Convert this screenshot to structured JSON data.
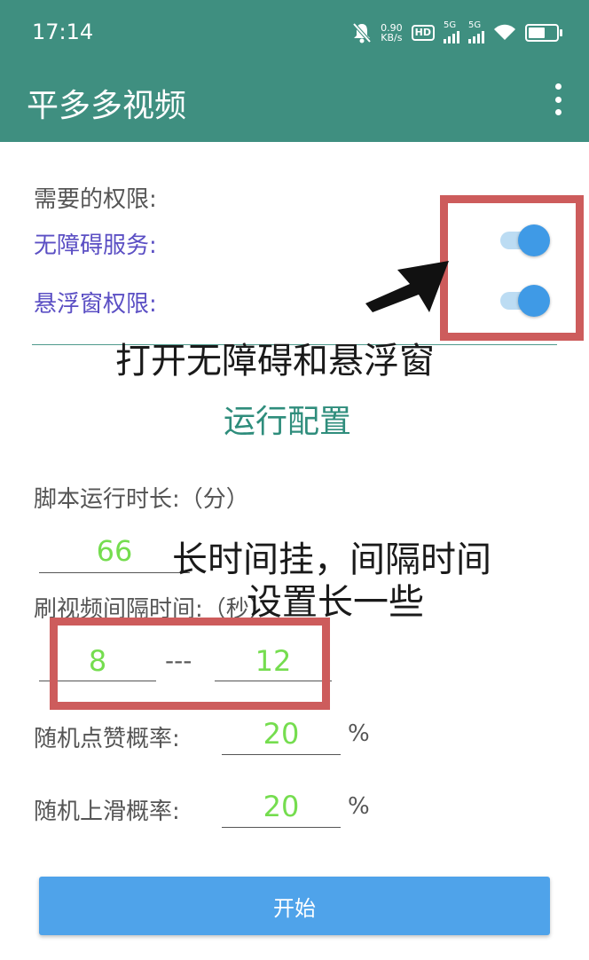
{
  "status_bar": {
    "time": "17:14",
    "speed_value": "0.90",
    "speed_unit": "KB/s",
    "hd": "HD",
    "sim1_label": "5G",
    "sim2_label": "5G"
  },
  "app_bar": {
    "title": "平多多视频"
  },
  "permissions": {
    "heading": "需要的权限:",
    "accessibility_label": "无障碍服务:",
    "accessibility_enabled": true,
    "overlay_label": "悬浮窗权限:",
    "overlay_enabled": true
  },
  "config": {
    "title": "运行配置",
    "duration_label": "脚本运行时长:（分）",
    "duration_value": "66",
    "interval_label": "刷视频间隔时间:（秒）",
    "interval_min": "8",
    "interval_separator": "---",
    "interval_max": "12",
    "like_label": "随机点赞概率:",
    "like_value": "20",
    "like_unit": "%",
    "swipe_label": "随机上滑概率:",
    "swipe_value": "20",
    "swipe_unit": "%"
  },
  "annotations": {
    "open_permissions": "打开无障碍和悬浮窗",
    "long_run_line1": "长时间挂，间隔时间",
    "long_run_line2": "设置长一些"
  },
  "start_button": {
    "label": "开始"
  },
  "colors": {
    "primary": "#3f8f80",
    "accent_blue": "#3f9ae6",
    "button": "#4fa3ea",
    "value_green": "#75dd4f",
    "permission_purple": "#5b4fc4",
    "annotation_red": "#cd5c5c"
  }
}
